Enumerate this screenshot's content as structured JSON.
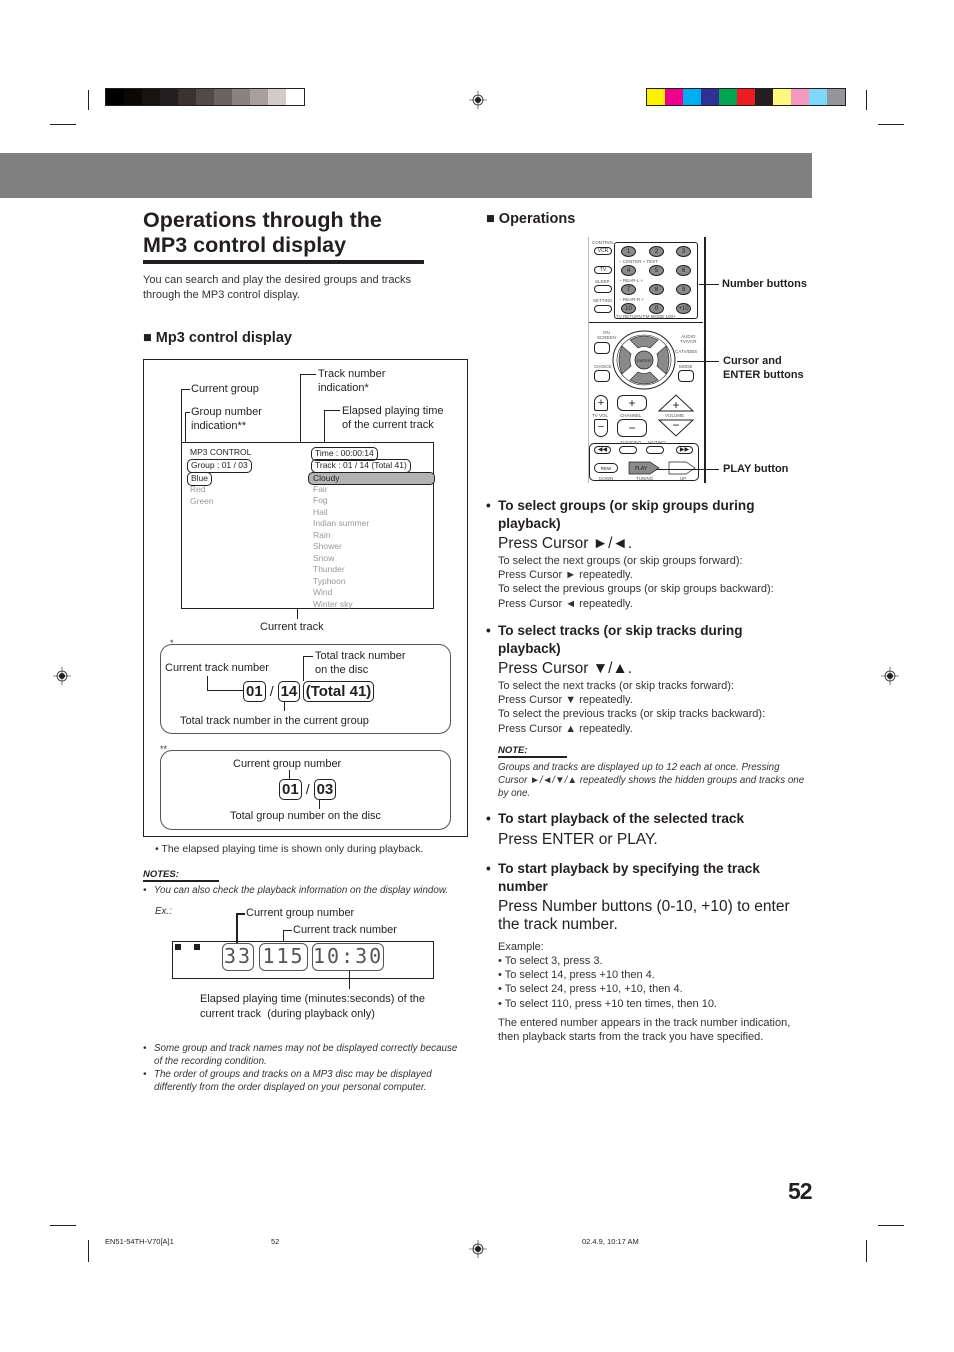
{
  "print_marks": {
    "gray_swatches": [
      "#000000",
      "#0a0806",
      "#171311",
      "#231f20",
      "#3a3230",
      "#524a47",
      "#6b6361",
      "#8a8280",
      "#a9a09e",
      "#d3cbca",
      "#ffffff"
    ],
    "color_swatches": [
      "#fff200",
      "#ec008c",
      "#00aeef",
      "#2e3192",
      "#00a651",
      "#ed1c24",
      "#231f20",
      "#fff77f",
      "#f49ac1",
      "#7fd8f7",
      "#939598"
    ]
  },
  "title": "Operations through the MP3 control display",
  "intro": "You can search and play the desired groups and tracks through the MP3 control display.",
  "mp3_section": {
    "heading": "■ Mp3 control display",
    "callouts": {
      "current_group": "Current group",
      "group_number_indication": "Group number\nindication**",
      "track_number_indication": "Track number\nindication*",
      "elapsed_time": "Elapsed playing time\nof the current track",
      "current_track": "Current track"
    },
    "screen": {
      "title": "MP3 CONTROL",
      "group_line": "Group :  01 / 03",
      "time_line": "Time :  00:00:14",
      "track_line": "Track :  01 / 14 (Total 41)",
      "groups": [
        "Blue",
        "Red",
        "Green"
      ],
      "tracks": [
        "Cloudy",
        "Fair",
        "Fog",
        "Hail",
        "Indian summer",
        "Rain",
        "Shower",
        "Snow",
        "Thunder",
        "Typhoon",
        "Wind",
        "Winter sky"
      ]
    },
    "track_box": {
      "marker": "*",
      "current_track_label": "Current track number",
      "total_disc_label": "Total track number\non the disc",
      "current": "01",
      "separator": "/",
      "group_total": "14",
      "disc_total": "(Total 41)",
      "group_total_label": "Total track number in the current group"
    },
    "group_box": {
      "marker": "**",
      "current_group_label": "Current group number",
      "current": "01",
      "separator": "/",
      "total": "03",
      "total_label": "Total group number on the disc"
    },
    "elapsed_note": "• The elapsed playing time is shown only during playback.",
    "notes_heading": "NOTES:",
    "notes": [
      "You can also check the playback information on the display window.",
      "Some group and track names may not be displayed correctly because of the recording condition.",
      "The order of groups and tracks on a MP3 disc may be displayed differently from the order displayed on your personal computer."
    ],
    "example": {
      "label": "Ex.:",
      "current_group_label": "Current group number",
      "current_track_label": "Current track number",
      "group_value": "33",
      "track_value": "115",
      "time_value": "10:30",
      "elapsed_label": "Elapsed playing time (minutes:seconds) of the\ncurrent track  (during playback only)"
    }
  },
  "operations": {
    "heading": "■ Operations",
    "remote_callouts": {
      "number_buttons": "Number buttons",
      "cursor_enter": "Cursor and\nENTER buttons",
      "play": "PLAY button"
    },
    "remote": {
      "control_label": "CONTROL",
      "vcr": "VCR",
      "tv": "TV",
      "sleep": "SLEEP",
      "setting": "SETTING",
      "number_keys": [
        "1",
        "2",
        "3",
        "4",
        "5",
        "6",
        "7",
        "8",
        "9",
        "10",
        "0",
        "+10"
      ],
      "row_labels": [
        "−    CENTER    +       TEST",
        "−    REAR-L    +",
        "−    REAR-R    +",
        "TV RETURN  FM MODE    100+"
      ],
      "on_screen": "ON\nSCREEN",
      "choice": "CHOICE",
      "mode": "MODE",
      "enter": "ENTER",
      "audio": "AUDIO\nTV/VCR",
      "cable": "CATV/DBS",
      "tv_vol": "TV VOL",
      "channel": "CHANNEL",
      "volume": "VOLUME",
      "tv_video": "TV/VIDEO",
      "muting": "MUTING",
      "play": "PLAY",
      "rew": "REW",
      "down": "DOWN",
      "tuning": "TUNING",
      "up": "UP"
    },
    "items": [
      {
        "heading": "To select groups (or skip groups during playback)",
        "press": "Press Cursor ►/◄.",
        "body": [
          "To select the next groups (or skip groups forward):",
          "Press Cursor ► repeatedly.",
          "To select the previous groups (or skip groups backward):",
          "Press Cursor ◄ repeatedly."
        ]
      },
      {
        "heading": "To select tracks (or skip tracks during playback)",
        "press": "Press Cursor ▼/▲.",
        "body": [
          "To select the next tracks (or skip tracks forward):",
          "Press Cursor ▼ repeatedly.",
          "To select the previous tracks (or skip tracks backward):",
          "Press Cursor ▲ repeatedly."
        ]
      },
      {
        "heading": "To start playback of the selected track",
        "press": "Press ENTER or PLAY."
      },
      {
        "heading": "To start playback by specifying the track number",
        "press": "Press Number buttons (0-10, +10) to enter the track number.",
        "example_label": "Example:",
        "examples": [
          "To select 3, press 3.",
          "To select 14, press +10 then 4.",
          "To select 24, press +10, +10, then 4.",
          "To select 110, press +10 ten times, then 10."
        ],
        "closing": "The entered number appears in the track number indication, then playback starts from the track you have specified."
      }
    ],
    "note_heading": "NOTE:",
    "note": "Groups and tracks are displayed up to 12 each at once. Pressing Cursor ►/◄/▼/▲ repeatedly shows the hidden groups and tracks one by one."
  },
  "page_number": "52",
  "footer": {
    "file": "EN51-54TH-V70[A]1",
    "page": "52",
    "date": "02.4.9, 10:17 AM"
  }
}
